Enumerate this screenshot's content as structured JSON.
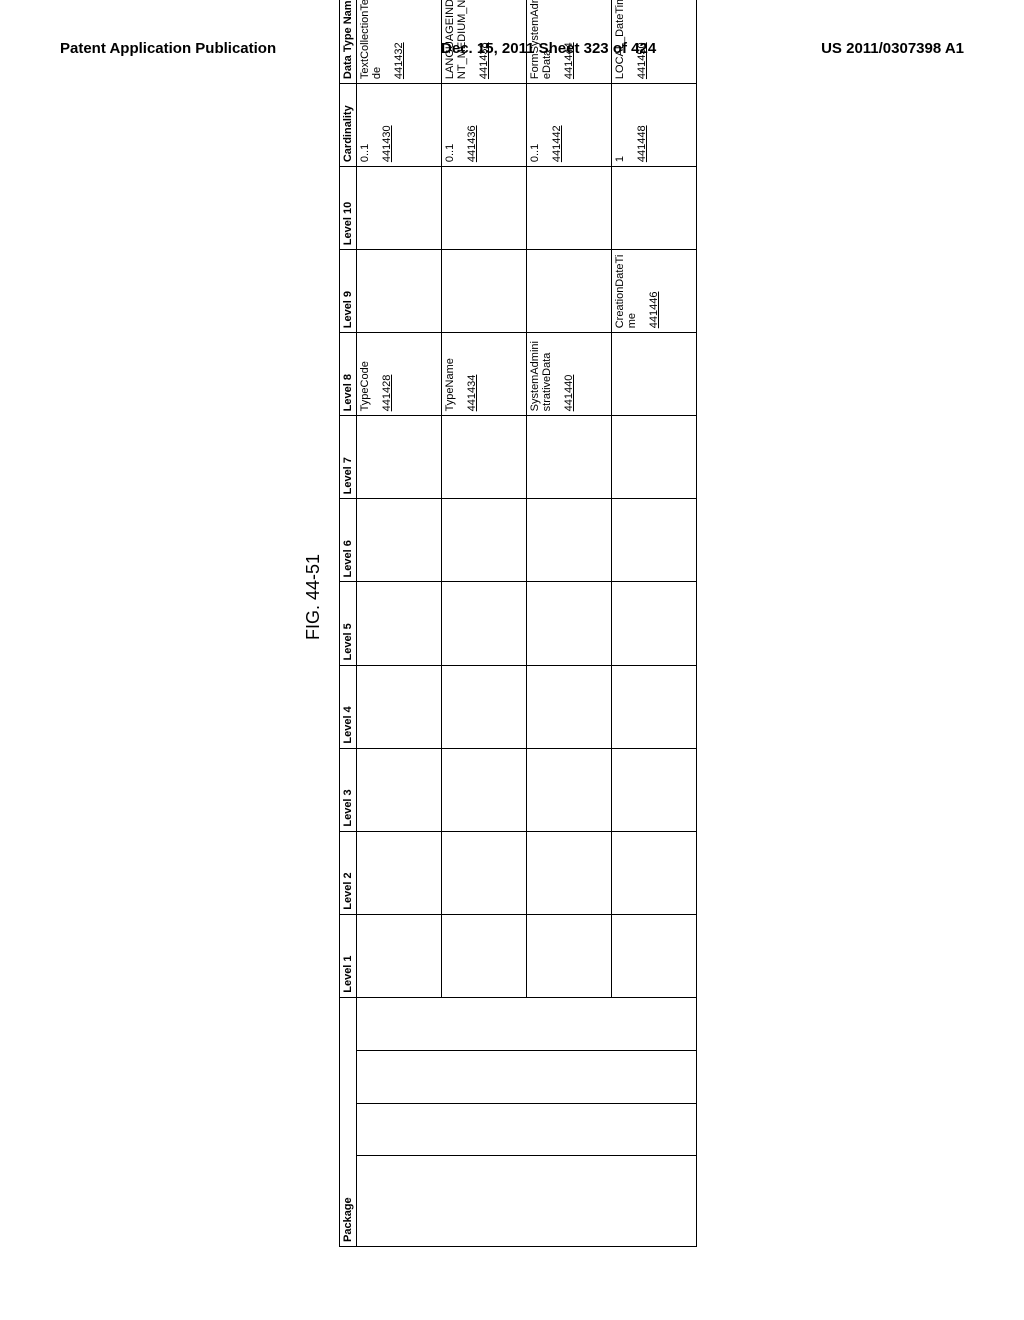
{
  "header": {
    "left": "Patent Application Publication",
    "center": "Dec. 15, 2011  Sheet 323 of 424",
    "right": "US 2011/0307398 A1"
  },
  "figure_label": "FIG. 44-51",
  "columns": {
    "package": "Package",
    "level1": "Level 1",
    "level2": "Level 2",
    "level3": "Level 3",
    "level4": "Level 4",
    "level5": "Level 5",
    "level6": "Level 6",
    "level7": "Level 7",
    "level8": "Level 8",
    "level9": "Level 9",
    "level10": "Level 10",
    "cardinality": "Cardinality",
    "datatype": "Data Type Name"
  },
  "rows": [
    {
      "level8": "TypeCode",
      "level8_ref": "441428",
      "cardinality": "0..1",
      "cardinality_ref": "441430",
      "datatype": "TextCollectionTextTypeCode",
      "datatype_ref": "441432"
    },
    {
      "level8": "TypeName",
      "level8_ref": "441434",
      "cardinality": "0..1",
      "cardinality_ref": "441436",
      "datatype": "LANGUAGEINDEPENDENT_MEDIUM_Name",
      "datatype_ref": "441438"
    },
    {
      "level8": "SystemAdministrativeData",
      "level8_ref": "441440",
      "cardinality": "0..1",
      "cardinality_ref": "441442",
      "datatype": "FormSystemAdministrativeData",
      "datatype_ref": "441444"
    },
    {
      "level9": "CreationDateTime",
      "level9_ref": "441446",
      "cardinality": "1",
      "cardinality_ref": "441448",
      "datatype": "LOCAL_DateTime",
      "datatype_ref": "441450"
    }
  ]
}
